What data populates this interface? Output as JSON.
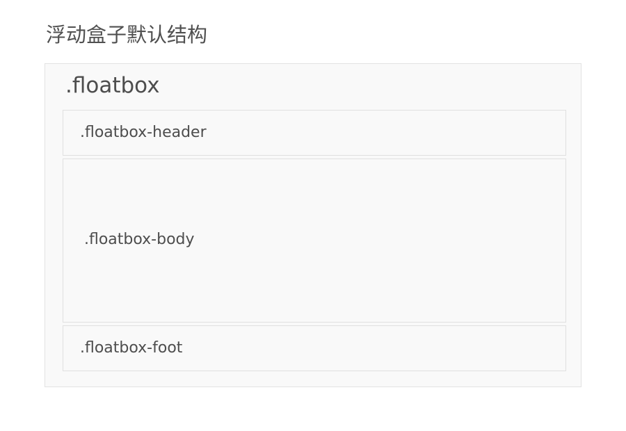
{
  "page": {
    "title": "浮动盒子默认结构"
  },
  "floatbox": {
    "label": ".floatbox",
    "header_label": ".floatbox-header",
    "body_label": ".floatbox-body",
    "foot_label": ".floatbox-foot"
  },
  "colors": {
    "background": "#ffffff",
    "box_fill": "#f9f9f9",
    "box_border": "#e2e2e2",
    "text": "#4d4d4d"
  }
}
